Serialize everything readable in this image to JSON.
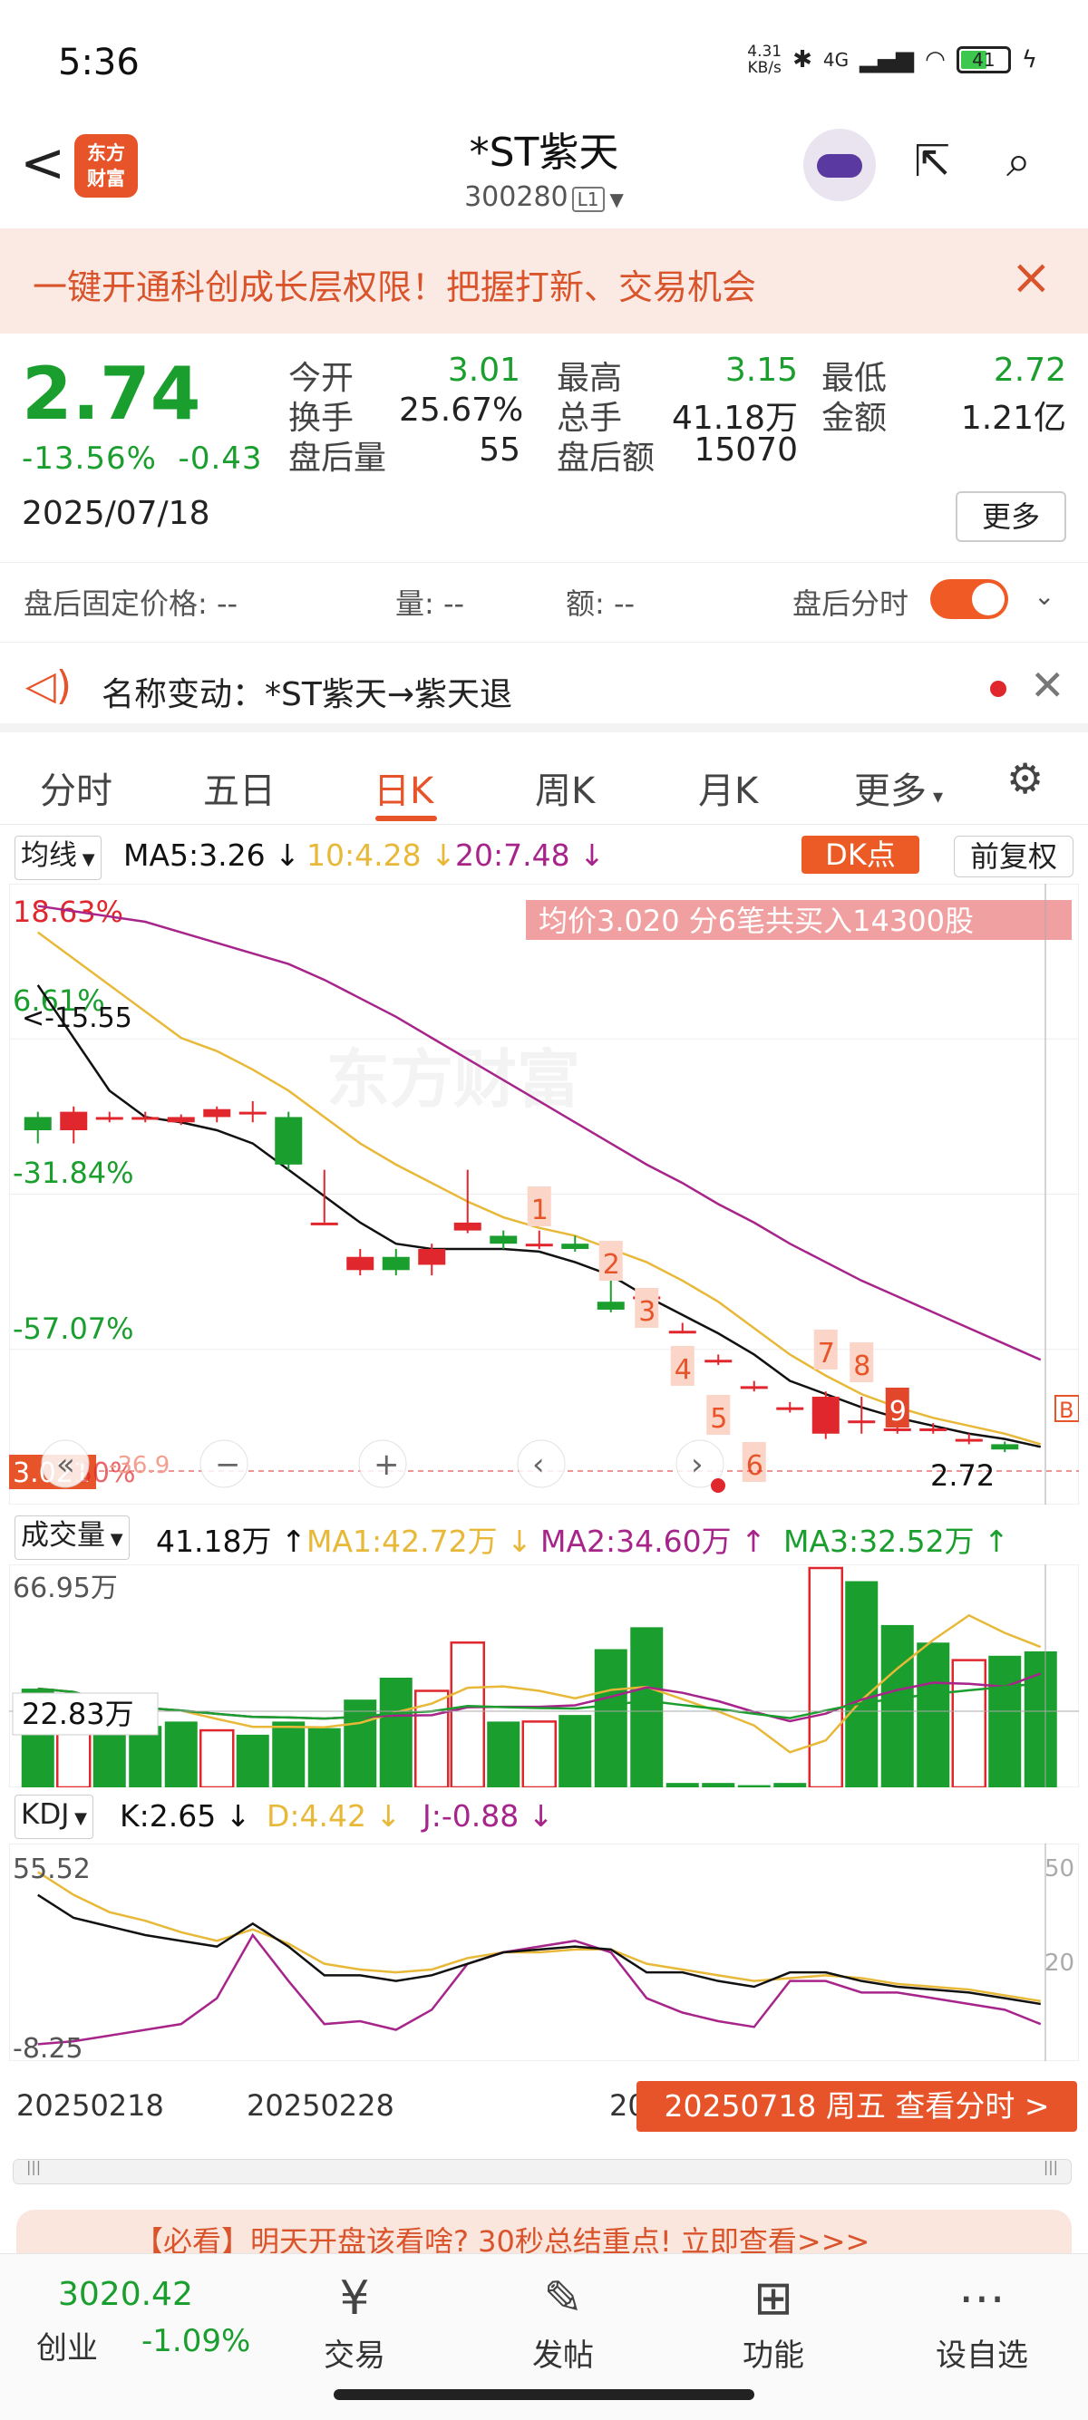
{
  "status_bar": {
    "time": "5:36",
    "net_speed": "4.31\nKB/s",
    "signal": "4G",
    "battery": "41"
  },
  "header": {
    "back": "<",
    "logo": "东方\n财富",
    "name": "*ST紫天",
    "code": "300280",
    "level": "L1"
  },
  "promo": {
    "text": "一键开通科创成长层权限！把握打新、交易机会",
    "close": "×"
  },
  "quote": {
    "price": "2.74",
    "change_pct": "-13.56%",
    "change": "-0.43",
    "date": "2025/07/18",
    "fields": [
      {
        "label": "今开",
        "value": "3.01",
        "color": "#1a9e2d"
      },
      {
        "label": "最高",
        "value": "3.15",
        "color": "#1a9e2d"
      },
      {
        "label": "最低",
        "value": "2.72",
        "color": "#1a9e2d"
      },
      {
        "label": "换手",
        "value": "25.67%",
        "color": "#222"
      },
      {
        "label": "总手",
        "value": "41.18万",
        "color": "#222"
      },
      {
        "label": "金额",
        "value": "1.21亿",
        "color": "#222"
      },
      {
        "label": "盘后量",
        "value": "55",
        "color": "#222"
      },
      {
        "label": "盘后额",
        "value": "15070",
        "color": "#222"
      }
    ],
    "more": "更多"
  },
  "after_hours": {
    "fixed_price": "盘后固定价格: --",
    "volume": "量: --",
    "amount": "额: --",
    "timeshare": "盘后分时"
  },
  "notice": {
    "text": "名称变动：*ST紫天→紫天退"
  },
  "tabs": [
    "分时",
    "五日",
    "日K",
    "周K",
    "月K",
    "更多"
  ],
  "ma_bar": {
    "selector": "均线",
    "ma5": "MA5:3.26",
    "ma10": "10:4.28",
    "ma20": "20:7.48",
    "dk": "DK点",
    "adjust": "前复权"
  },
  "kchart": {
    "y_labels": [
      "18.63%",
      "6.61%",
      "-31.84%",
      "-57.07%"
    ],
    "avg_label": "均价3.020  分6笔共买入14300股",
    "prev_label": "<-15.55",
    "last_label": "2.72",
    "price_tag": "3.021",
    "price_tag_pct": "-30%",
    "low_tag": "-36.9",
    "markers": [
      "1",
      "2",
      "3",
      "4",
      "5",
      "6",
      "7",
      "8",
      "9"
    ],
    "b_marker": "B"
  },
  "volume": {
    "selector": "成交量",
    "total": "41.18万",
    "ma1": "MA1:42.72万",
    "ma2": "MA2:34.60万",
    "ma3": "MA3:32.52万",
    "max_label": "66.95万",
    "cur_label": "22.83万"
  },
  "kdj": {
    "selector": "KDJ",
    "k": "K:2.65",
    "d": "D:4.42",
    "j": "J:-0.88",
    "top_label": "55.52",
    "bottom_label": "-8.25",
    "r50": "50",
    "r20": "20"
  },
  "x_dates": [
    "20250218",
    "20250228",
    "20"
  ],
  "callout": "20250718 周五 查看分时 >",
  "ad": {
    "text": "【必看】明天开盘该看啥? 30秒总结重点! 立即查看>>>"
  },
  "bottom": {
    "index_value": "3020.42",
    "index_name": "创业",
    "index_change": "-1.09%",
    "nav": [
      "交易",
      "发帖",
      "功能",
      "设自选"
    ]
  },
  "colors": {
    "up": "#e0272d",
    "down": "#1a9e2d",
    "accent": "#e8542a",
    "ma5": "#111111",
    "ma10": "#e8b838",
    "ma20": "#a7248a"
  },
  "candles": [
    {
      "o": 3.6,
      "c": 3.55,
      "h": 3.62,
      "l": 3.5
    },
    {
      "o": 3.55,
      "c": 3.62,
      "h": 3.64,
      "l": 3.5
    },
    {
      "o": 3.6,
      "c": 3.6,
      "h": 3.62,
      "l": 3.58
    },
    {
      "o": 3.6,
      "c": 3.6,
      "h": 3.62,
      "l": 3.58
    },
    {
      "o": 3.58,
      "c": 3.6,
      "h": 3.61,
      "l": 3.57
    },
    {
      "o": 3.6,
      "c": 3.63,
      "h": 3.64,
      "l": 3.58
    },
    {
      "o": 3.62,
      "c": 3.62,
      "h": 3.66,
      "l": 3.58
    },
    {
      "o": 3.6,
      "c": 3.42,
      "h": 3.62,
      "l": 3.4
    },
    {
      "o": 3.2,
      "c": 3.2,
      "h": 3.4,
      "l": 3.2
    },
    {
      "o": 3.02,
      "c": 3.07,
      "h": 3.1,
      "l": 3.0
    },
    {
      "o": 3.07,
      "c": 3.02,
      "h": 3.1,
      "l": 3.0
    },
    {
      "o": 3.04,
      "c": 3.1,
      "h": 3.12,
      "l": 3.0
    },
    {
      "o": 3.17,
      "c": 3.2,
      "h": 3.4,
      "l": 3.16
    },
    {
      "o": 3.15,
      "c": 3.12,
      "h": 3.17,
      "l": 3.1
    },
    {
      "o": 3.12,
      "c": 3.12,
      "h": 3.17,
      "l": 3.1
    },
    {
      "o": 3.12,
      "c": 3.1,
      "h": 3.15,
      "l": 3.09
    },
    {
      "o": 2.9,
      "c": 2.87,
      "h": 3.0,
      "l": 2.86
    },
    {
      "o": 2.92,
      "c": 2.92,
      "h": 2.95,
      "l": 2.89
    },
    {
      "o": 2.79,
      "c": 2.79,
      "h": 2.82,
      "l": 2.78
    },
    {
      "o": 2.68,
      "c": 2.68,
      "h": 2.7,
      "l": 2.66
    },
    {
      "o": 2.58,
      "c": 2.58,
      "h": 2.6,
      "l": 2.56
    },
    {
      "o": 2.5,
      "c": 2.5,
      "h": 2.52,
      "l": 2.48
    },
    {
      "o": 2.4,
      "c": 2.54,
      "h": 2.56,
      "l": 2.38
    },
    {
      "o": 2.45,
      "c": 2.45,
      "h": 2.54,
      "l": 2.4
    },
    {
      "o": 2.42,
      "c": 2.42,
      "h": 2.46,
      "l": 2.4
    },
    {
      "o": 2.42,
      "c": 2.42,
      "h": 2.44,
      "l": 2.4
    },
    {
      "o": 2.38,
      "c": 2.38,
      "h": 2.4,
      "l": 2.36
    },
    {
      "o": 2.36,
      "c": 2.34,
      "h": 2.37,
      "l": 2.33
    }
  ],
  "volumes": [
    0.45,
    0.42,
    0.3,
    0.28,
    0.3,
    0.26,
    0.24,
    0.3,
    0.27,
    0.4,
    0.5,
    0.44,
    0.66,
    0.3,
    0.3,
    0.33,
    0.63,
    0.73,
    0.02,
    0.02,
    0.01,
    0.02,
    1.0,
    0.94,
    0.74,
    0.66,
    0.58,
    0.6,
    0.62
  ],
  "volume_up": [
    false,
    true,
    false,
    false,
    false,
    true,
    false,
    false,
    false,
    false,
    false,
    true,
    true,
    false,
    true,
    false,
    false,
    false,
    false,
    false,
    false,
    false,
    true,
    false,
    false,
    false,
    true,
    false,
    false
  ],
  "ma5_line": [
    4.1,
    3.9,
    3.7,
    3.6,
    3.58,
    3.55,
    3.5,
    3.4,
    3.3,
    3.2,
    3.12,
    3.1,
    3.1,
    3.1,
    3.09,
    3.05,
    3.0,
    2.92,
    2.85,
    2.78,
    2.7,
    2.6,
    2.55,
    2.5,
    2.46,
    2.43,
    2.4,
    2.38,
    2.35
  ],
  "ma10_line": [
    4.3,
    4.2,
    4.1,
    4.0,
    3.9,
    3.85,
    3.78,
    3.7,
    3.6,
    3.5,
    3.42,
    3.35,
    3.28,
    3.22,
    3.18,
    3.15,
    3.1,
    3.05,
    2.98,
    2.9,
    2.8,
    2.7,
    2.62,
    2.55,
    2.5,
    2.46,
    2.43,
    2.4,
    2.36
  ],
  "ma20_line": [
    4.4,
    4.38,
    4.36,
    4.34,
    4.3,
    4.26,
    4.22,
    4.18,
    4.12,
    4.05,
    3.98,
    3.9,
    3.82,
    3.74,
    3.66,
    3.58,
    3.5,
    3.42,
    3.35,
    3.27,
    3.2,
    3.12,
    3.05,
    2.98,
    2.92,
    2.86,
    2.8,
    2.74,
    2.68
  ],
  "kdj_k": [
    44,
    36,
    33,
    30,
    28,
    26,
    34,
    26,
    16,
    16,
    14,
    16,
    20,
    24,
    25,
    26,
    25,
    17,
    17,
    14,
    12,
    17,
    17,
    14,
    12,
    11,
    10,
    8,
    6
  ],
  "kdj_d": [
    52,
    44,
    38,
    35,
    31,
    28,
    32,
    27,
    20,
    18,
    17,
    18,
    22,
    24,
    24,
    25,
    25,
    20,
    18,
    16,
    14,
    15,
    16,
    15,
    13,
    12,
    11,
    9,
    7
  ],
  "kdj_j": [
    -8,
    -7,
    -5,
    -3,
    -1,
    8,
    30,
    14,
    -1,
    0,
    -3,
    4,
    20,
    24,
    26,
    28,
    24,
    8,
    3,
    0,
    -2,
    14,
    14,
    10,
    10,
    8,
    6,
    4,
    -1
  ]
}
